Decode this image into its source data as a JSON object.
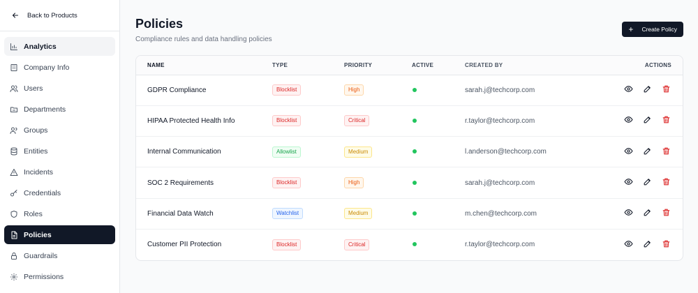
{
  "sidebar": {
    "back_label": "Back to Products",
    "items": [
      {
        "label": "Analytics",
        "icon": "bar-chart-icon",
        "state": "hover"
      },
      {
        "label": "Company Info",
        "icon": "building-icon",
        "state": ""
      },
      {
        "label": "Users",
        "icon": "users-icon",
        "state": ""
      },
      {
        "label": "Departments",
        "icon": "folder-icon",
        "state": ""
      },
      {
        "label": "Groups",
        "icon": "group-icon",
        "state": ""
      },
      {
        "label": "Entities",
        "icon": "database-icon",
        "state": ""
      },
      {
        "label": "Incidents",
        "icon": "warning-icon",
        "state": ""
      },
      {
        "label": "Credentials",
        "icon": "key-icon",
        "state": ""
      },
      {
        "label": "Roles",
        "icon": "shield-icon",
        "state": ""
      },
      {
        "label": "Policies",
        "icon": "document-icon",
        "state": "active"
      },
      {
        "label": "Guardrails",
        "icon": "lock-icon",
        "state": ""
      },
      {
        "label": "Permissions",
        "icon": "gear-icon",
        "state": ""
      }
    ]
  },
  "header": {
    "title": "Policies",
    "subtitle": "Compliance rules and data handling policies",
    "create_label": "Create Policy"
  },
  "table": {
    "columns": {
      "name": "NAME",
      "type": "TYPE",
      "priority": "PRIORITY",
      "active": "ACTIVE",
      "created_by": "CREATED BY",
      "actions": "ACTIONS"
    },
    "rows": [
      {
        "name": "GDPR Compliance",
        "type": "Blocklist",
        "priority": "High",
        "active": true,
        "created_by": "sarah.j@techcorp.com"
      },
      {
        "name": "HIPAA Protected Health Info",
        "type": "Blocklist",
        "priority": "Critical",
        "active": true,
        "created_by": "r.taylor@techcorp.com"
      },
      {
        "name": "Internal Communication",
        "type": "Allowlist",
        "priority": "Medium",
        "active": true,
        "created_by": "l.anderson@techcorp.com"
      },
      {
        "name": "SOC 2 Requirements",
        "type": "Blocklist",
        "priority": "High",
        "active": true,
        "created_by": "sarah.j@techcorp.com"
      },
      {
        "name": "Financial Data Watch",
        "type": "Watchlist",
        "priority": "Medium",
        "active": true,
        "created_by": "m.chen@techcorp.com"
      },
      {
        "name": "Customer PII Protection",
        "type": "Blocklist",
        "priority": "Critical",
        "active": true,
        "created_by": "r.taylor@techcorp.com"
      }
    ]
  },
  "colors": {
    "accent": "#111827",
    "active_dot": "#22c55e",
    "delete": "#dc2626"
  }
}
